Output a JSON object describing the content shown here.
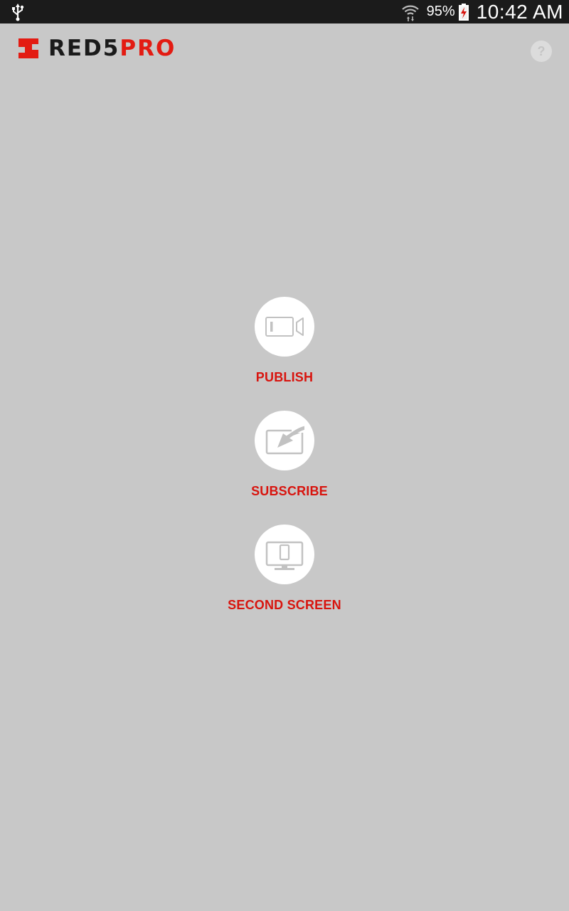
{
  "status_bar": {
    "battery_percent": "95%",
    "time": "10:42 AM",
    "icons": [
      "usb-icon",
      "wifi-icon",
      "battery-charging-icon"
    ]
  },
  "header": {
    "logo_text_dark": "RED5",
    "logo_text_accent": "PRO",
    "help_label": "?"
  },
  "menu": {
    "items": [
      {
        "label": "PUBLISH",
        "icon": "video-camera-icon"
      },
      {
        "label": "SUBSCRIBE",
        "icon": "screen-arrow-icon"
      },
      {
        "label": "SECOND SCREEN",
        "icon": "monitor-phone-icon"
      }
    ]
  },
  "colors": {
    "background": "#c8c8c8",
    "status_bar": "#1b1b1b",
    "accent_red": "#d8140e",
    "logo_red": "#e31b12",
    "icon_gray": "#c2c2c2"
  }
}
